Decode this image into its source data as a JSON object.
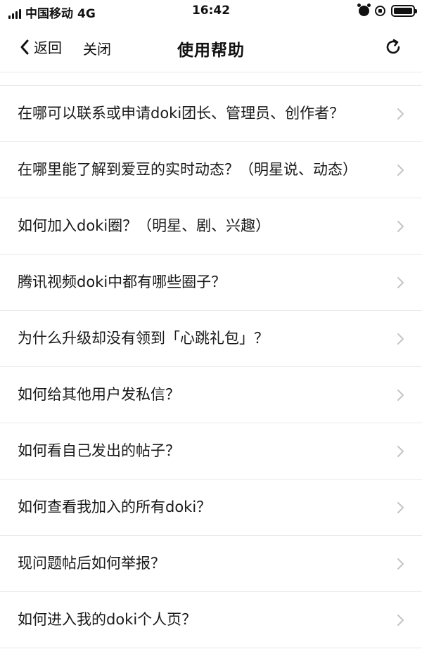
{
  "status_bar": {
    "carrier": "中国移动",
    "network": "4G",
    "time": "16:42",
    "battery_level": 1.0
  },
  "nav": {
    "back_label": "返回",
    "close_label": "关闭",
    "title": "使用帮助"
  },
  "items": [
    {
      "label": "在哪可以联系或申请doki团长、管理员、创作者？"
    },
    {
      "label": "在哪里能了解到爱豆的实时动态？（明星说、动态）"
    },
    {
      "label": "如何加入doki圈？（明星、剧、兴趣）"
    },
    {
      "label": "腾讯视频doki中都有哪些圈子？"
    },
    {
      "label": "为什么升级却没有领到「心跳礼包」？"
    },
    {
      "label": "如何给其他用户发私信？"
    },
    {
      "label": "如何看自己发出的帖子？"
    },
    {
      "label": "如何查看我加入的所有doki？"
    },
    {
      "label": "现问题帖后如何举报？"
    },
    {
      "label": "如何进入我的doki个人页？"
    }
  ],
  "icons": [
    "back-chevron-icon",
    "refresh-icon",
    "chevron-right-icon",
    "alarm-icon",
    "rotation-lock-icon",
    "battery-icon"
  ],
  "colors": {
    "divider": "#e9e9e9",
    "chevron": "#c4c4c4",
    "text": "#1a1a1a"
  }
}
